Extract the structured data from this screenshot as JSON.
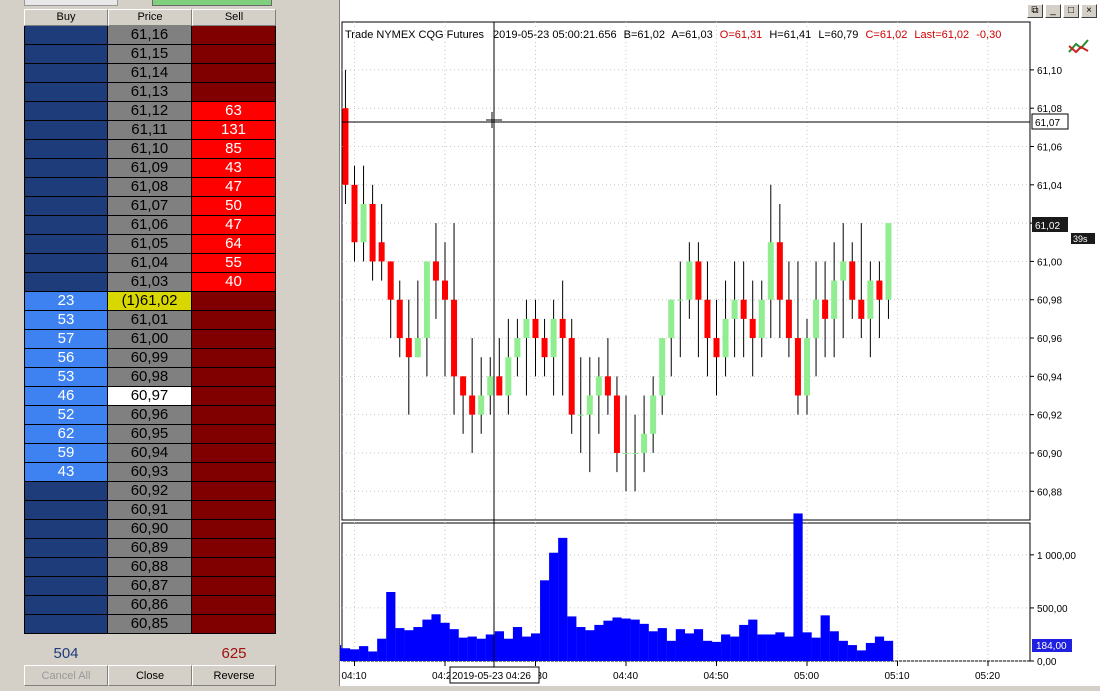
{
  "ladder": {
    "headers": {
      "buy": "Buy",
      "price": "Price",
      "sell": "Sell"
    },
    "rows": [
      {
        "buy": "",
        "price": "61,16",
        "sell": ""
      },
      {
        "buy": "",
        "price": "61,15",
        "sell": ""
      },
      {
        "buy": "",
        "price": "61,14",
        "sell": ""
      },
      {
        "buy": "",
        "price": "61,13",
        "sell": ""
      },
      {
        "buy": "",
        "price": "61,12",
        "sell": "63"
      },
      {
        "buy": "",
        "price": "61,11",
        "sell": "131"
      },
      {
        "buy": "",
        "price": "61,10",
        "sell": "85"
      },
      {
        "buy": "",
        "price": "61,09",
        "sell": "43"
      },
      {
        "buy": "",
        "price": "61,08",
        "sell": "47"
      },
      {
        "buy": "",
        "price": "61,07",
        "sell": "50"
      },
      {
        "buy": "",
        "price": "61,06",
        "sell": "47"
      },
      {
        "buy": "",
        "price": "61,05",
        "sell": "64"
      },
      {
        "buy": "",
        "price": "61,04",
        "sell": "55"
      },
      {
        "buy": "",
        "price": "61,03",
        "sell": "40"
      },
      {
        "buy": "23",
        "price": "(1)61,02",
        "sell": "",
        "last": true
      },
      {
        "buy": "53",
        "price": "61,01",
        "sell": ""
      },
      {
        "buy": "57",
        "price": "61,00",
        "sell": ""
      },
      {
        "buy": "56",
        "price": "60,99",
        "sell": ""
      },
      {
        "buy": "53",
        "price": "60,98",
        "sell": ""
      },
      {
        "buy": "46",
        "price": "60,97",
        "sell": "",
        "highlight": true
      },
      {
        "buy": "52",
        "price": "60,96",
        "sell": ""
      },
      {
        "buy": "62",
        "price": "60,95",
        "sell": ""
      },
      {
        "buy": "59",
        "price": "60,94",
        "sell": ""
      },
      {
        "buy": "43",
        "price": "60,93",
        "sell": ""
      },
      {
        "buy": "",
        "price": "60,92",
        "sell": ""
      },
      {
        "buy": "",
        "price": "60,91",
        "sell": ""
      },
      {
        "buy": "",
        "price": "60,90",
        "sell": ""
      },
      {
        "buy": "",
        "price": "60,89",
        "sell": ""
      },
      {
        "buy": "",
        "price": "60,88",
        "sell": ""
      },
      {
        "buy": "",
        "price": "60,87",
        "sell": ""
      },
      {
        "buy": "",
        "price": "60,86",
        "sell": ""
      },
      {
        "buy": "",
        "price": "60,85",
        "sell": ""
      }
    ],
    "total_buy": "504",
    "total_sell": "625",
    "buttons": {
      "cancel_all": "Cancel All",
      "close": "Close",
      "reverse": "Reverse"
    }
  },
  "chart": {
    "window_buttons": {
      "restore": "⧉",
      "minimize": "_",
      "maximize": "□",
      "close": "×"
    },
    "info": {
      "instrument": "Trade  NYMEX  CQG  Futures",
      "timestamp": "2019-05-23  05:00:21.656",
      "bid": "B=61,02",
      "ask": "A=61,03",
      "open": "O=61,31",
      "high": "H=61,41",
      "low": "L=60,79",
      "close": "C=61,02",
      "last": "Last=61,02",
      "change": "-0,30"
    },
    "price_ticks": [
      "61,10",
      "61,08",
      "61,06",
      "61,04",
      "61,02",
      "61,00",
      "60,98",
      "60,96",
      "60,94",
      "60,92",
      "60,90",
      "60,88"
    ],
    "crosshair_price": "61,07",
    "current_price": "61,02",
    "bar_timer": "39s",
    "volume_ticks": [
      "1 000,00",
      "500,00",
      "0,00"
    ],
    "current_volume": "184,00",
    "time_ticks": [
      "04:10",
      "04:20",
      "04:30",
      "04:40",
      "04:50",
      "05:00",
      "05:10",
      "05:20"
    ],
    "crosshair_time": "2019-05-23 04:26",
    "colors": {
      "up": "#90ee90",
      "down": "#ff0000",
      "volume": "#0000ff",
      "last_label": "#1a1a1a"
    }
  },
  "chart_data": {
    "type": "candlestick",
    "interval_minutes": 1,
    "first_bar_time": "04:09",
    "candles": [
      [
        61.08,
        61.1,
        61.03,
        61.04
      ],
      [
        61.04,
        61.05,
        61.0,
        61.01
      ],
      [
        61.01,
        61.05,
        61.0,
        61.03
      ],
      [
        61.03,
        61.04,
        60.99,
        61.0
      ],
      [
        61.01,
        61.03,
        60.99,
        61.0
      ],
      [
        61.0,
        61.0,
        60.96,
        60.98
      ],
      [
        60.98,
        60.99,
        60.95,
        60.96
      ],
      [
        60.96,
        60.98,
        60.92,
        60.95
      ],
      [
        60.95,
        60.99,
        60.95,
        60.96
      ],
      [
        60.96,
        60.98,
        60.94,
        61.0
      ],
      [
        61.0,
        61.02,
        60.97,
        60.99
      ],
      [
        60.99,
        61.01,
        60.94,
        60.98
      ],
      [
        60.98,
        61.02,
        60.92,
        60.94
      ],
      [
        60.94,
        60.94,
        60.91,
        60.93
      ],
      [
        60.93,
        60.96,
        60.9,
        60.92
      ],
      [
        60.92,
        60.95,
        60.91,
        60.93
      ],
      [
        60.93,
        60.95,
        60.92,
        60.94
      ],
      [
        60.94,
        60.96,
        60.93,
        60.93
      ],
      [
        60.93,
        60.97,
        60.92,
        60.95
      ],
      [
        60.95,
        60.97,
        60.94,
        60.96
      ],
      [
        60.96,
        60.98,
        60.93,
        60.97
      ],
      [
        60.97,
        60.98,
        60.94,
        60.96
      ],
      [
        60.96,
        60.97,
        60.94,
        60.95
      ],
      [
        60.95,
        60.98,
        60.93,
        60.97
      ],
      [
        60.97,
        60.99,
        60.93,
        60.96
      ],
      [
        60.96,
        60.97,
        60.91,
        60.92
      ],
      [
        60.92,
        60.95,
        60.9,
        60.92
      ],
      [
        60.92,
        60.95,
        60.89,
        60.93
      ],
      [
        60.93,
        60.95,
        60.91,
        60.94
      ],
      [
        60.94,
        60.96,
        60.92,
        60.93
      ],
      [
        60.93,
        60.94,
        60.89,
        60.9
      ],
      [
        60.9,
        60.93,
        60.88,
        60.9
      ],
      [
        60.9,
        60.92,
        60.88,
        60.9
      ],
      [
        60.9,
        60.93,
        60.89,
        60.91
      ],
      [
        60.91,
        60.94,
        60.9,
        60.93
      ],
      [
        60.93,
        60.96,
        60.92,
        60.96
      ],
      [
        60.96,
        60.98,
        60.94,
        60.98
      ],
      [
        60.98,
        61.0,
        60.95,
        60.98
      ],
      [
        60.98,
        61.01,
        60.97,
        61.0
      ],
      [
        61.0,
        61.01,
        60.95,
        60.98
      ],
      [
        60.98,
        61.0,
        60.94,
        60.96
      ],
      [
        60.96,
        60.98,
        60.93,
        60.95
      ],
      [
        60.95,
        60.99,
        60.94,
        60.97
      ],
      [
        60.97,
        61.0,
        60.95,
        60.98
      ],
      [
        60.98,
        61.0,
        60.95,
        60.97
      ],
      [
        60.97,
        60.99,
        60.94,
        60.96
      ],
      [
        60.96,
        60.99,
        60.95,
        60.98
      ],
      [
        60.98,
        61.04,
        60.96,
        61.01
      ],
      [
        61.01,
        61.03,
        60.96,
        60.98
      ],
      [
        60.98,
        61.0,
        60.95,
        60.96
      ],
      [
        60.96,
        61.0,
        60.92,
        60.93
      ],
      [
        60.93,
        60.97,
        60.92,
        60.96
      ],
      [
        60.96,
        61.0,
        60.94,
        60.98
      ],
      [
        60.98,
        61.0,
        60.95,
        60.97
      ],
      [
        60.97,
        61.01,
        60.95,
        60.99
      ],
      [
        60.99,
        61.02,
        60.96,
        61.0
      ],
      [
        61.0,
        61.01,
        60.97,
        60.98
      ],
      [
        60.98,
        61.02,
        60.96,
        60.97
      ],
      [
        60.97,
        61.0,
        60.95,
        60.99
      ],
      [
        60.99,
        61.0,
        60.96,
        60.98
      ],
      [
        60.98,
        61.01,
        60.97,
        61.02
      ]
    ],
    "volumes": [
      150,
      120,
      110,
      140,
      90,
      210,
      650,
      310,
      290,
      320,
      390,
      440,
      360,
      300,
      220,
      230,
      210,
      250,
      280,
      210,
      320,
      230,
      260,
      760,
      1020,
      1160,
      420,
      320,
      290,
      340,
      380,
      410,
      400,
      390,
      350,
      280,
      310,
      190,
      300,
      260,
      300,
      190,
      180,
      250,
      230,
      340,
      390,
      250,
      250,
      270,
      230,
      1390,
      270,
      220,
      430,
      280,
      190,
      150,
      100,
      170,
      230,
      190
    ],
    "price_range": [
      60.865,
      61.125
    ],
    "volume_range": [
      0,
      1300
    ]
  }
}
